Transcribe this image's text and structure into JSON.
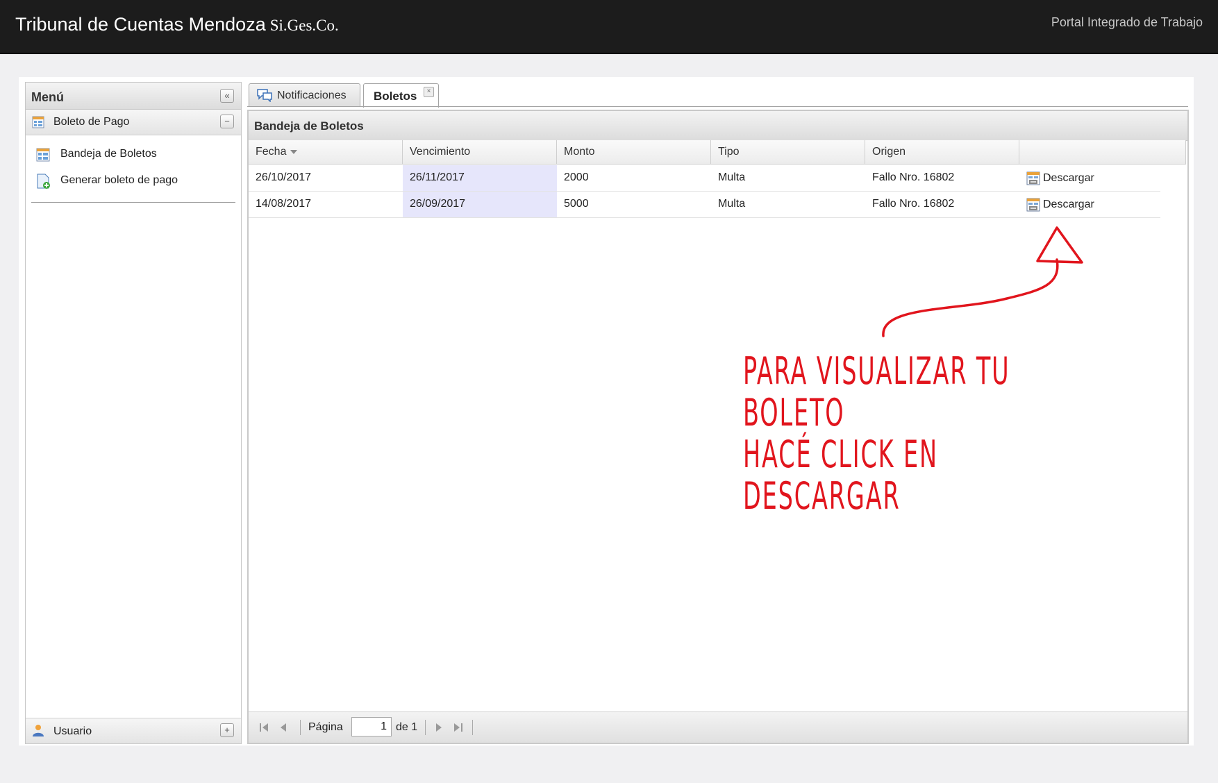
{
  "header": {
    "brand": "Tribunal de Cuentas Mendoza",
    "brand_sub": "Si.Ges.Co.",
    "portal": "Portal Integrado de Trabajo"
  },
  "menu": {
    "title": "Menú",
    "section": "Boleto de Pago",
    "items": [
      {
        "label": "Bandeja de Boletos",
        "icon": "grid-icon"
      },
      {
        "label": "Generar boleto de pago",
        "icon": "new-document-icon"
      }
    ],
    "user_section": "Usuario"
  },
  "tabs": [
    {
      "label": "Notificaciones",
      "icon": "chat-icon",
      "active": false
    },
    {
      "label": "Boletos",
      "active": true
    }
  ],
  "grid": {
    "title": "Bandeja de Boletos",
    "columns": [
      "Fecha",
      "Vencimiento",
      "Monto",
      "Tipo",
      "Origen",
      ""
    ],
    "rows": [
      {
        "fecha": "26/10/2017",
        "vencimiento": "26/11/2017",
        "monto": "2000",
        "tipo": "Multa",
        "origen": "Fallo Nro. 16802",
        "accion": "Descargar"
      },
      {
        "fecha": "14/08/2017",
        "vencimiento": "26/09/2017",
        "monto": "5000",
        "tipo": "Multa",
        "origen": "Fallo Nro. 16802",
        "accion": "Descargar"
      }
    ]
  },
  "pager": {
    "page_label": "Página",
    "page_value": "1",
    "of_label": "de 1"
  },
  "annotation": {
    "line1": "PARA VISUALIZAR TU BOLETO",
    "line2": "HACÉ CLICK EN DESCARGAR",
    "color": "#e1151d"
  },
  "colors": {
    "topbar": "#1c1c1c",
    "highlight_cell": "#e6e6fb"
  }
}
